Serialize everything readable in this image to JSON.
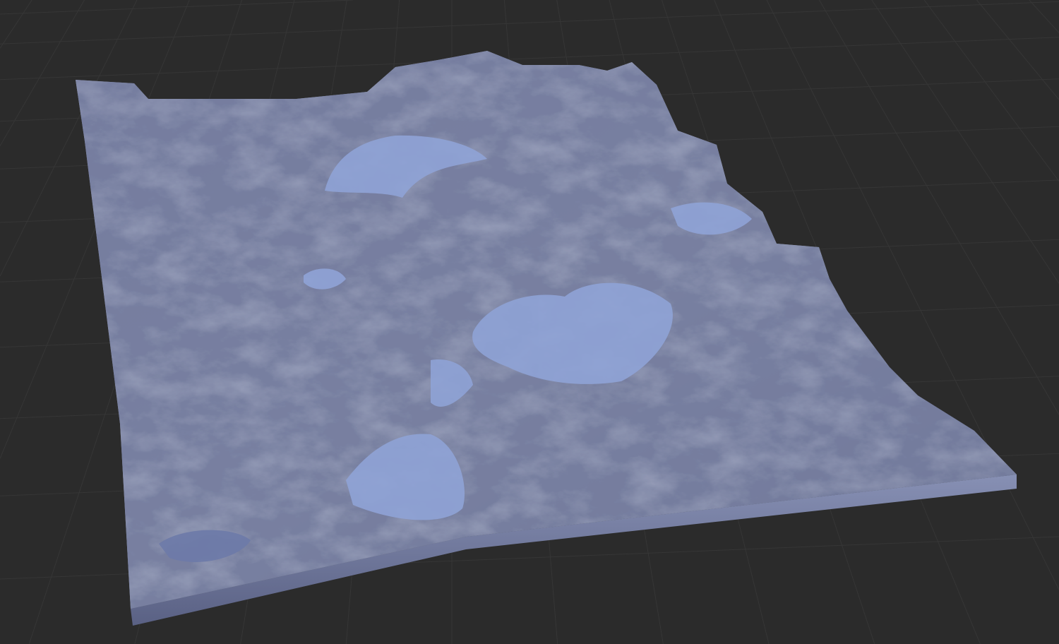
{
  "scene": {
    "background_color": "#2b2b2b",
    "grid_color": "#363636",
    "terrain_light": "#a7b0c8",
    "terrain_mid": "#7e86a8",
    "terrain_dark": "#4f5675",
    "water_color": "#8fa3d6",
    "skirt_color": "#6b7396"
  }
}
